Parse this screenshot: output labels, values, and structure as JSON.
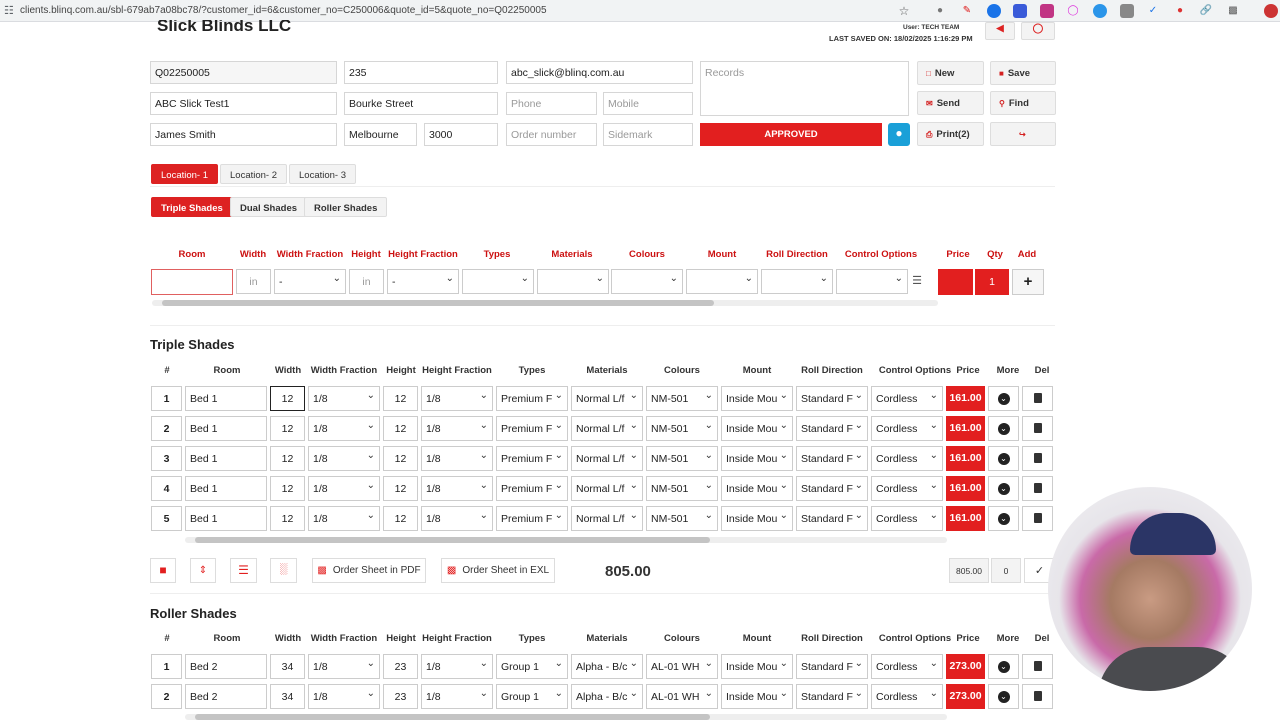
{
  "browser": {
    "url": "clients.blinq.com.au/sbl-679ab7a08bc78/?customer_id=6&customer_no=C250006&quote_id=5&quote_no=Q02250005"
  },
  "header": {
    "company": "Slick Blinds LLC",
    "user": "User: TECH TEAM",
    "last_saved": "LAST SAVED ON: 18/02/2025 1:16:29 PM"
  },
  "form": {
    "quote_no": "Q02250005",
    "street_no": "235",
    "email": "abc_slick@blinq.com.au",
    "records_placeholder": "Records",
    "customer_name": "ABC Slick Test1",
    "street": "Bourke Street",
    "phone_placeholder": "Phone",
    "mobile_placeholder": "Mobile",
    "contact": "James Smith",
    "suburb": "Melbourne",
    "postcode": "3000",
    "order_number_placeholder": "Order number",
    "sidemark_placeholder": "Sidemark",
    "status": "APPROVED"
  },
  "actions": {
    "new": "New",
    "save": "Save",
    "send": "Send",
    "find": "Find",
    "print": "Print(2)"
  },
  "locations": [
    "Location- 1",
    "Location- 2",
    "Location- 3"
  ],
  "product_tabs": [
    "Triple Shades",
    "Dual Shades",
    "Roller Shades"
  ],
  "entry": {
    "headers": [
      "Room",
      "Width",
      "Width Fraction",
      "Height",
      "Height Fraction",
      "Types",
      "Materials",
      "Colours",
      "Mount",
      "Roll Direction",
      "Control Options",
      "Price",
      "Qty",
      "Add"
    ],
    "width_unit": "in",
    "height_unit": "in",
    "width_fraction": "-",
    "height_fraction": "-",
    "qty": "1",
    "add": "+"
  },
  "triple": {
    "title": "Triple Shades",
    "headers": [
      "#",
      "Room",
      "Width",
      "Width Fraction",
      "Height",
      "Height Fraction",
      "Types",
      "Materials",
      "Colours",
      "Mount",
      "Roll Direction",
      "Control Options",
      "Price",
      "More",
      "Del"
    ],
    "rows": [
      {
        "n": "1",
        "room": "Bed 1",
        "width": "12",
        "wf": "1/8",
        "height": "12",
        "hf": "1/8",
        "type": "Premium F",
        "material": "Normal L/f",
        "colour": "NM-501",
        "mount": "Inside Mou",
        "roll": "Standard F",
        "control": "Cordless",
        "price": "161.00"
      },
      {
        "n": "2",
        "room": "Bed 1",
        "width": "12",
        "wf": "1/8",
        "height": "12",
        "hf": "1/8",
        "type": "Premium F",
        "material": "Normal L/f",
        "colour": "NM-501",
        "mount": "Inside Mou",
        "roll": "Standard F",
        "control": "Cordless",
        "price": "161.00"
      },
      {
        "n": "3",
        "room": "Bed 1",
        "width": "12",
        "wf": "1/8",
        "height": "12",
        "hf": "1/8",
        "type": "Premium F",
        "material": "Normal L/f",
        "colour": "NM-501",
        "mount": "Inside Mou",
        "roll": "Standard F",
        "control": "Cordless",
        "price": "161.00"
      },
      {
        "n": "4",
        "room": "Bed 1",
        "width": "12",
        "wf": "1/8",
        "height": "12",
        "hf": "1/8",
        "type": "Premium F",
        "material": "Normal L/f",
        "colour": "NM-501",
        "mount": "Inside Mou",
        "roll": "Standard F",
        "control": "Cordless",
        "price": "161.00"
      },
      {
        "n": "5",
        "room": "Bed 1",
        "width": "12",
        "wf": "1/8",
        "height": "12",
        "hf": "1/8",
        "type": "Premium F",
        "material": "Normal L/f",
        "colour": "NM-501",
        "mount": "Inside Mou",
        "roll": "Standard F",
        "control": "Cordless",
        "price": "161.00"
      }
    ],
    "order_pdf": "Order Sheet in PDF",
    "order_exl": "Order Sheet in EXL",
    "total": "805.00",
    "total_small": "805.00",
    "count": "0",
    "check": "✓"
  },
  "roller": {
    "title": "Roller Shades",
    "headers": [
      "#",
      "Room",
      "Width",
      "Width Fraction",
      "Height",
      "Height Fraction",
      "Types",
      "Materials",
      "Colours",
      "Mount",
      "Roll Direction",
      "Control Options",
      "Price",
      "More",
      "Del"
    ],
    "rows": [
      {
        "n": "1",
        "room": "Bed 2",
        "width": "34",
        "wf": "1/8",
        "height": "23",
        "hf": "1/8",
        "type": "Group 1",
        "material": "Alpha - B/c",
        "colour": "AL-01 WH",
        "mount": "Inside Mou",
        "roll": "Standard F",
        "control": "Cordless",
        "price": "273.00"
      },
      {
        "n": "2",
        "room": "Bed 2",
        "width": "34",
        "wf": "1/8",
        "height": "23",
        "hf": "1/8",
        "type": "Group 1",
        "material": "Alpha - B/c",
        "colour": "AL-01 WH",
        "mount": "Inside Mou",
        "roll": "Standard F",
        "control": "Cordless",
        "price": "273.00"
      }
    ]
  }
}
